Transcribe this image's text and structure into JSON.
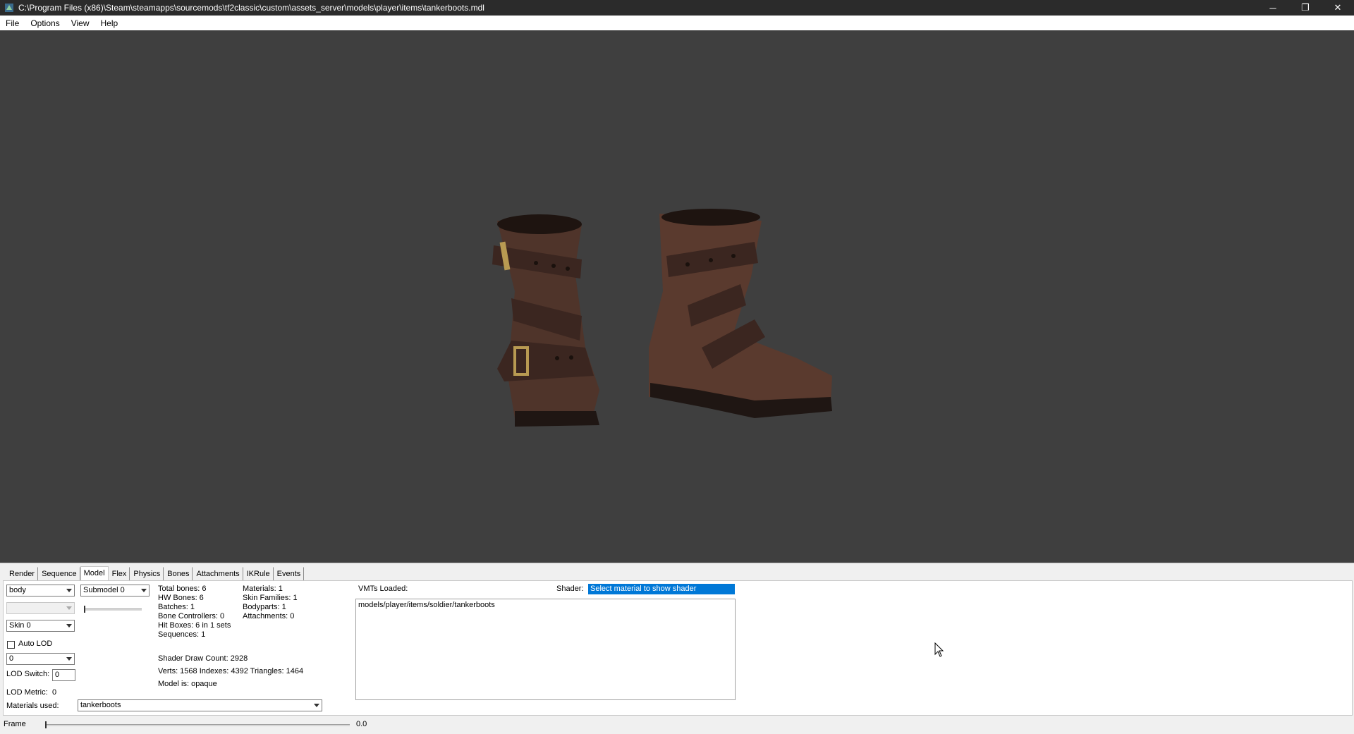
{
  "window": {
    "title": "C:\\Program Files (x86)\\Steam\\steamapps\\sourcemods\\tf2classic\\custom\\assets_server\\models\\player\\items\\tankerboots.mdl",
    "controls": {
      "minimize": "─",
      "restore": "❐",
      "close": "✕"
    }
  },
  "menu": [
    "File",
    "Options",
    "View",
    "Help"
  ],
  "tabs": [
    "Render",
    "Sequence",
    "Model",
    "Flex",
    "Physics",
    "Bones",
    "Attachments",
    "IKRule",
    "Events"
  ],
  "active_tab": "Model",
  "model_panel": {
    "bodypart_select": "body",
    "submodel_select": "Submodel 0",
    "disabled_select": "",
    "skin_select": "Skin 0",
    "auto_lod_label": "Auto LOD",
    "lod_select": "0",
    "lod_switch_label": "LOD Switch:",
    "lod_switch_value": "0",
    "lod_metric_label": "LOD Metric:",
    "lod_metric_value": "0",
    "materials_used_label": "Materials used:",
    "materials_used_value": "tankerboots"
  },
  "stats_left": [
    "Total bones: 6",
    "HW Bones: 6",
    "Batches: 1",
    "Bone Controllers: 0",
    "Hit Boxes: 6 in 1 sets",
    "Sequences: 1"
  ],
  "stats_right": [
    "Materials: 1",
    "Skin Families: 1",
    "Bodyparts: 1",
    "Attachments: 0"
  ],
  "stats_bottom": [
    "Shader Draw Count: 2928",
    "Verts: 1568  Indexes: 4392  Triangles: 1464",
    "Model is: opaque"
  ],
  "vmts": {
    "label": "VMTs Loaded:",
    "items": [
      "models/player/items/soldier/tankerboots"
    ],
    "shader_label": "Shader:",
    "shader_value": "Select material to show shader"
  },
  "frame": {
    "label": "Frame",
    "value": "0.0"
  },
  "colors": {
    "viewport_bg": "#3f3f3f",
    "titlebar_bg": "#2b2b2b",
    "selection": "#0078d7",
    "boot_leather": "#5a3a2e",
    "boot_strap": "#3b2620",
    "buckle": "#b89a52"
  }
}
